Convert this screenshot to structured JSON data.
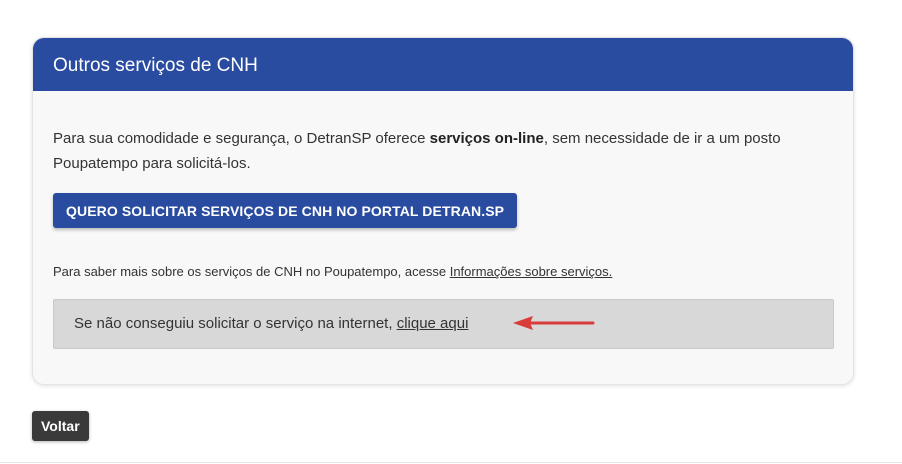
{
  "card": {
    "title": "Outros serviços de CNH",
    "intro_before": "Para sua comodidade e segurança, o DetranSP oferece ",
    "intro_bold": "serviços on-line",
    "intro_after": ", sem necessidade de ir a um posto Poupatempo para solicitá-los.",
    "portal_button_label": "QUERO SOLICITAR SERVIÇOS DE CNH NO PORTAL DETRAN.SP",
    "more_info_text": "Para saber mais sobre os serviços de CNH no Poupatempo, acesse ",
    "more_info_link": "Informações sobre serviços.",
    "help_text": "Se não conseguiu solicitar o serviço na internet, ",
    "help_link": "clique aqui"
  },
  "footer": {
    "back_button_label": "Voltar"
  },
  "colors": {
    "header_blue": "#2a4ca0",
    "arrow_red": "#d93a3a",
    "back_button": "#3a3a3a",
    "help_box": "#d8d8d8"
  },
  "icons": {
    "annotation": "red-arrow-icon"
  }
}
